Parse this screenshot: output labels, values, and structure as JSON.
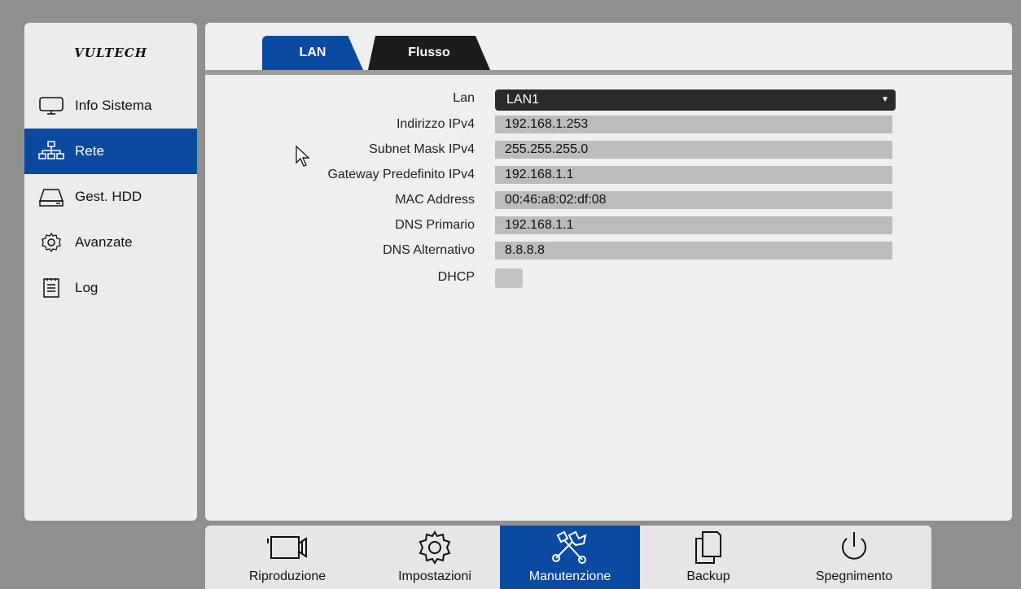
{
  "logo": {
    "text": "VULTECH"
  },
  "sidebar": {
    "items": [
      {
        "label": "Info Sistema",
        "icon": "monitor-icon",
        "active": false
      },
      {
        "label": "Rete",
        "icon": "network-icon",
        "active": true
      },
      {
        "label": "Gest. HDD",
        "icon": "hdd-icon",
        "active": false
      },
      {
        "label": "Avanzate",
        "icon": "gear-icon",
        "active": false
      },
      {
        "label": "Log",
        "icon": "log-icon",
        "active": false
      }
    ]
  },
  "tabs": [
    {
      "label": "LAN",
      "active": true
    },
    {
      "label": "Flusso",
      "active": false
    }
  ],
  "form": {
    "lan": {
      "label": "Lan",
      "value": "LAN1"
    },
    "ipv4": {
      "label": "Indirizzo IPv4",
      "value": "192.168.1.253"
    },
    "subnet": {
      "label": "Subnet Mask IPv4",
      "value": "255.255.255.0"
    },
    "gateway": {
      "label": "Gateway Predefinito IPv4",
      "value": "192.168.1.1"
    },
    "mac": {
      "label": "MAC Address",
      "value": "00:46:a8:02:df:08"
    },
    "dns1": {
      "label": "DNS Primario",
      "value": "192.168.1.1"
    },
    "dns2": {
      "label": "DNS Alternativo",
      "value": "8.8.8.8"
    },
    "dhcp": {
      "label": "DHCP",
      "checked": false
    }
  },
  "toolbar": {
    "items": [
      {
        "label": "Riproduzione",
        "icon": "camera-icon",
        "active": false
      },
      {
        "label": "Impostazioni",
        "icon": "gear-icon",
        "active": false
      },
      {
        "label": "Manutenzione",
        "icon": "tools-icon",
        "active": true
      },
      {
        "label": "Backup",
        "icon": "copy-icon",
        "active": false
      },
      {
        "label": "Spegnimento",
        "icon": "power-icon",
        "active": false
      }
    ]
  },
  "colors": {
    "accent": "#0a4aa0",
    "field": "#bcbcbc",
    "dark": "#1c1c1c"
  }
}
